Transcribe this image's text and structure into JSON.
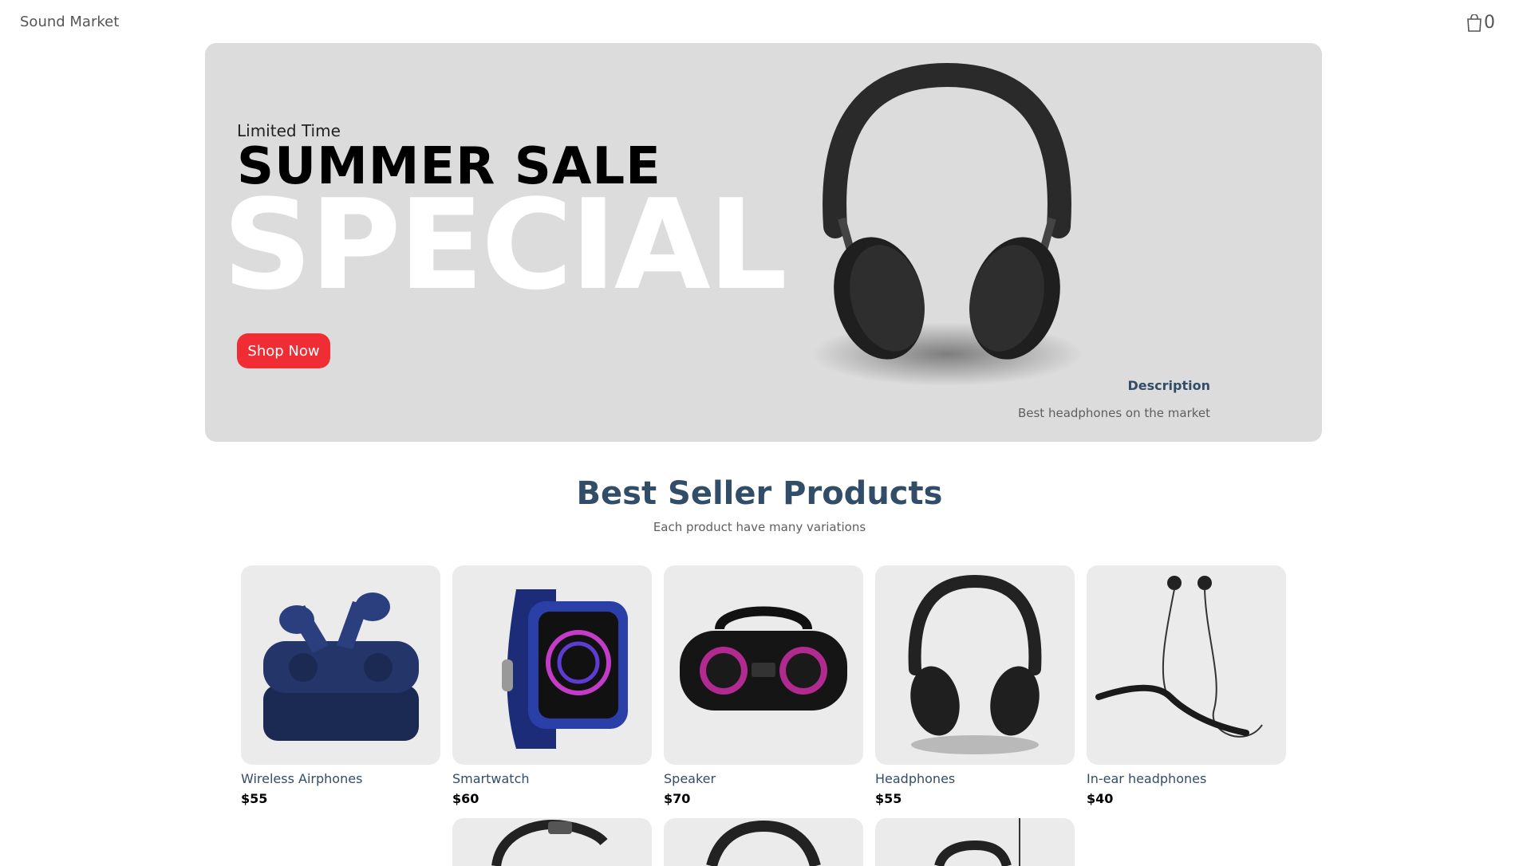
{
  "header": {
    "logo": "Sound Market",
    "cart_count": "0"
  },
  "hero": {
    "small_text": "Limited Time",
    "mid_text": "SUMMER SALE",
    "large_text": "SPECIAL",
    "button": "Shop Now",
    "desc_title": "Description",
    "desc_text": "Best headphones on the market"
  },
  "section": {
    "title": "Best Seller Products",
    "subtitle": "Each product have many variations"
  },
  "products": [
    {
      "name": "Wireless Airphones",
      "price": "$55"
    },
    {
      "name": "Smartwatch",
      "price": "$60"
    },
    {
      "name": "Speaker",
      "price": "$70"
    },
    {
      "name": "Headphones",
      "price": "$55"
    },
    {
      "name": "In-ear headphones",
      "price": "$40"
    }
  ],
  "colors": {
    "accent": "#f02d34",
    "heading": "#324d67",
    "hero_bg": "#dcdcdc",
    "card_bg": "#ebebeb"
  }
}
